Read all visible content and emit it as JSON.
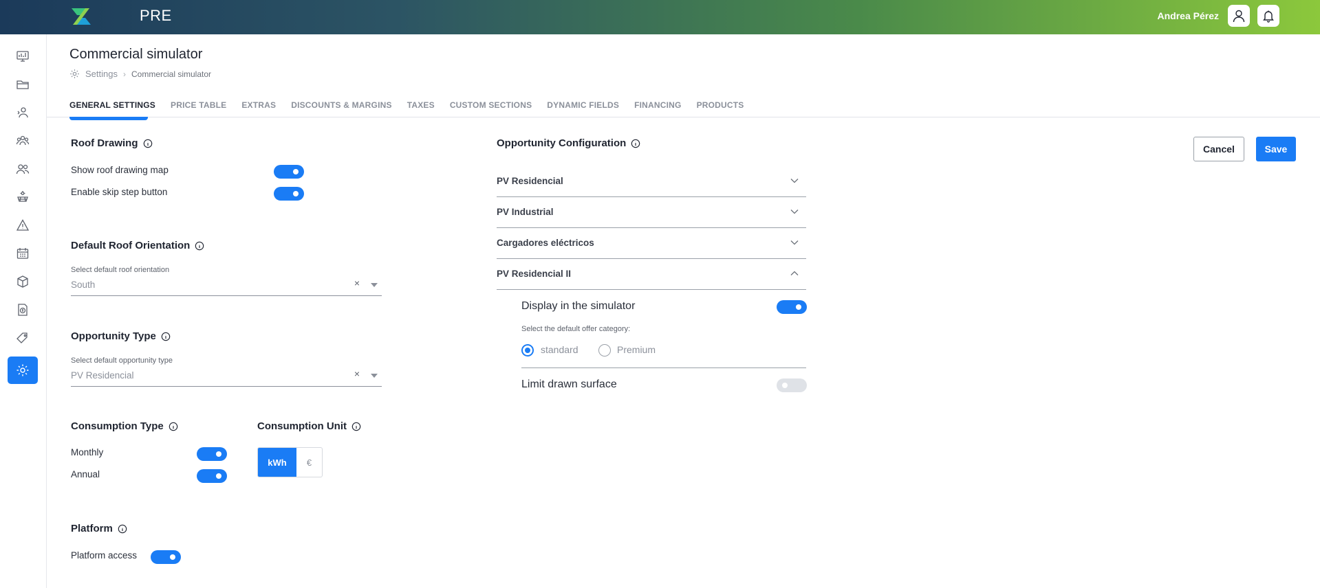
{
  "app": {
    "brand": "PRE"
  },
  "user": {
    "name": "Andrea Pérez"
  },
  "page": {
    "title": "Commercial simulator"
  },
  "breadcrumb": {
    "root": "Settings",
    "separator": "›",
    "current": "Commercial simulator"
  },
  "tabs": [
    {
      "label": "GENERAL SETTINGS",
      "active": true
    },
    {
      "label": "PRICE TABLE"
    },
    {
      "label": "EXTRAS"
    },
    {
      "label": "DISCOUNTS & MARGINS"
    },
    {
      "label": "TAXES"
    },
    {
      "label": "CUSTOM SECTIONS"
    },
    {
      "label": "DYNAMIC FIELDS"
    },
    {
      "label": "FINANCING"
    },
    {
      "label": "PRODUCTS"
    }
  ],
  "actions": {
    "cancel": "Cancel",
    "save": "Save"
  },
  "roof_drawing": {
    "title": "Roof Drawing",
    "show_map": {
      "label": "Show roof drawing map",
      "on": true
    },
    "skip_step": {
      "label": "Enable skip step button",
      "on": true
    }
  },
  "roof_orientation": {
    "title": "Default Roof Orientation",
    "caption": "Select default roof orientation",
    "value": "South",
    "clear": "×"
  },
  "opportunity_type": {
    "title": "Opportunity Type",
    "caption": "Select default opportunity type",
    "value": "PV Residencial",
    "clear": "×"
  },
  "consumption_type": {
    "title": "Consumption Type",
    "monthly": {
      "label": "Monthly",
      "on": true
    },
    "annual": {
      "label": "Annual",
      "on": true
    }
  },
  "consumption_unit": {
    "title": "Consumption Unit",
    "options": [
      "kWh",
      "€"
    ],
    "selected": "kWh"
  },
  "platform": {
    "title": "Platform",
    "access": {
      "label": "Platform access",
      "on": true
    }
  },
  "opportunity_config": {
    "title": "Opportunity Configuration",
    "items": [
      {
        "label": "PV Residencial",
        "expanded": false
      },
      {
        "label": "PV Industrial",
        "expanded": false
      },
      {
        "label": "Cargadores eléctricos",
        "expanded": false
      },
      {
        "label": "PV Residencial II",
        "expanded": true
      }
    ],
    "expanded_panel": {
      "display_in_simulator": {
        "label": "Display in the simulator",
        "on": true
      },
      "category_caption": "Select the default offer category:",
      "categories": [
        "standard",
        "Premium"
      ],
      "selected_category": "standard",
      "limit_surface": {
        "label": "Limit drawn surface",
        "on": false
      }
    }
  },
  "colors": {
    "accent": "#1a7cf5",
    "toggle_off": "#dfe2e7",
    "text": "#1f2430",
    "muted": "#8b909a"
  }
}
